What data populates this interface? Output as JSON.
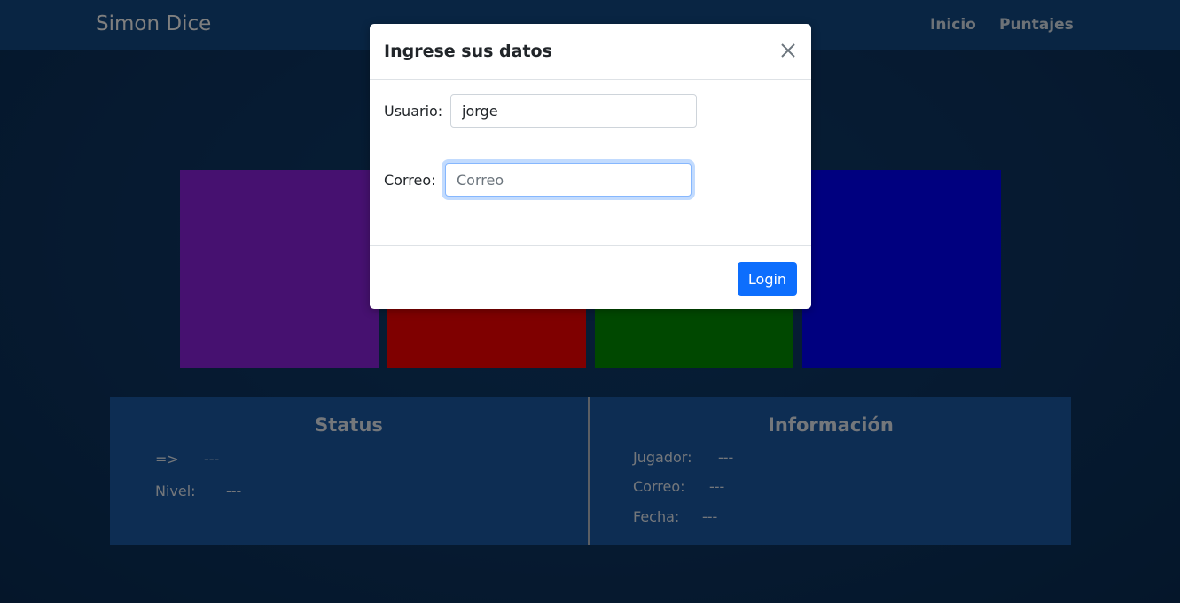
{
  "navbar": {
    "brand": "Simon Dice",
    "links": [
      "Inicio",
      "Puntajes"
    ]
  },
  "colors": {
    "tile_purple": "#8d22e0",
    "tile_red": "#ff0000",
    "tile_green": "#009100",
    "tile_blue": "#0000ff",
    "panel": "#1a5aa6",
    "primary_button": "#0d6efd"
  },
  "status": {
    "title": "Status",
    "arrow_label": "=>",
    "arrow_value": "---",
    "level_label": "Nivel:",
    "level_value": "---"
  },
  "info": {
    "title": "Información",
    "player_label": "Jugador:",
    "player_value": "---",
    "email_label": "Correo:",
    "email_value": "---",
    "date_label": "Fecha:",
    "date_value": "---"
  },
  "modal": {
    "title": "Ingrese sus datos",
    "close_icon": "close-icon",
    "user_label": "Usuario:",
    "user_value": "jorge",
    "email_label": "Correo:",
    "email_placeholder": "Correo",
    "login_label": "Login"
  }
}
